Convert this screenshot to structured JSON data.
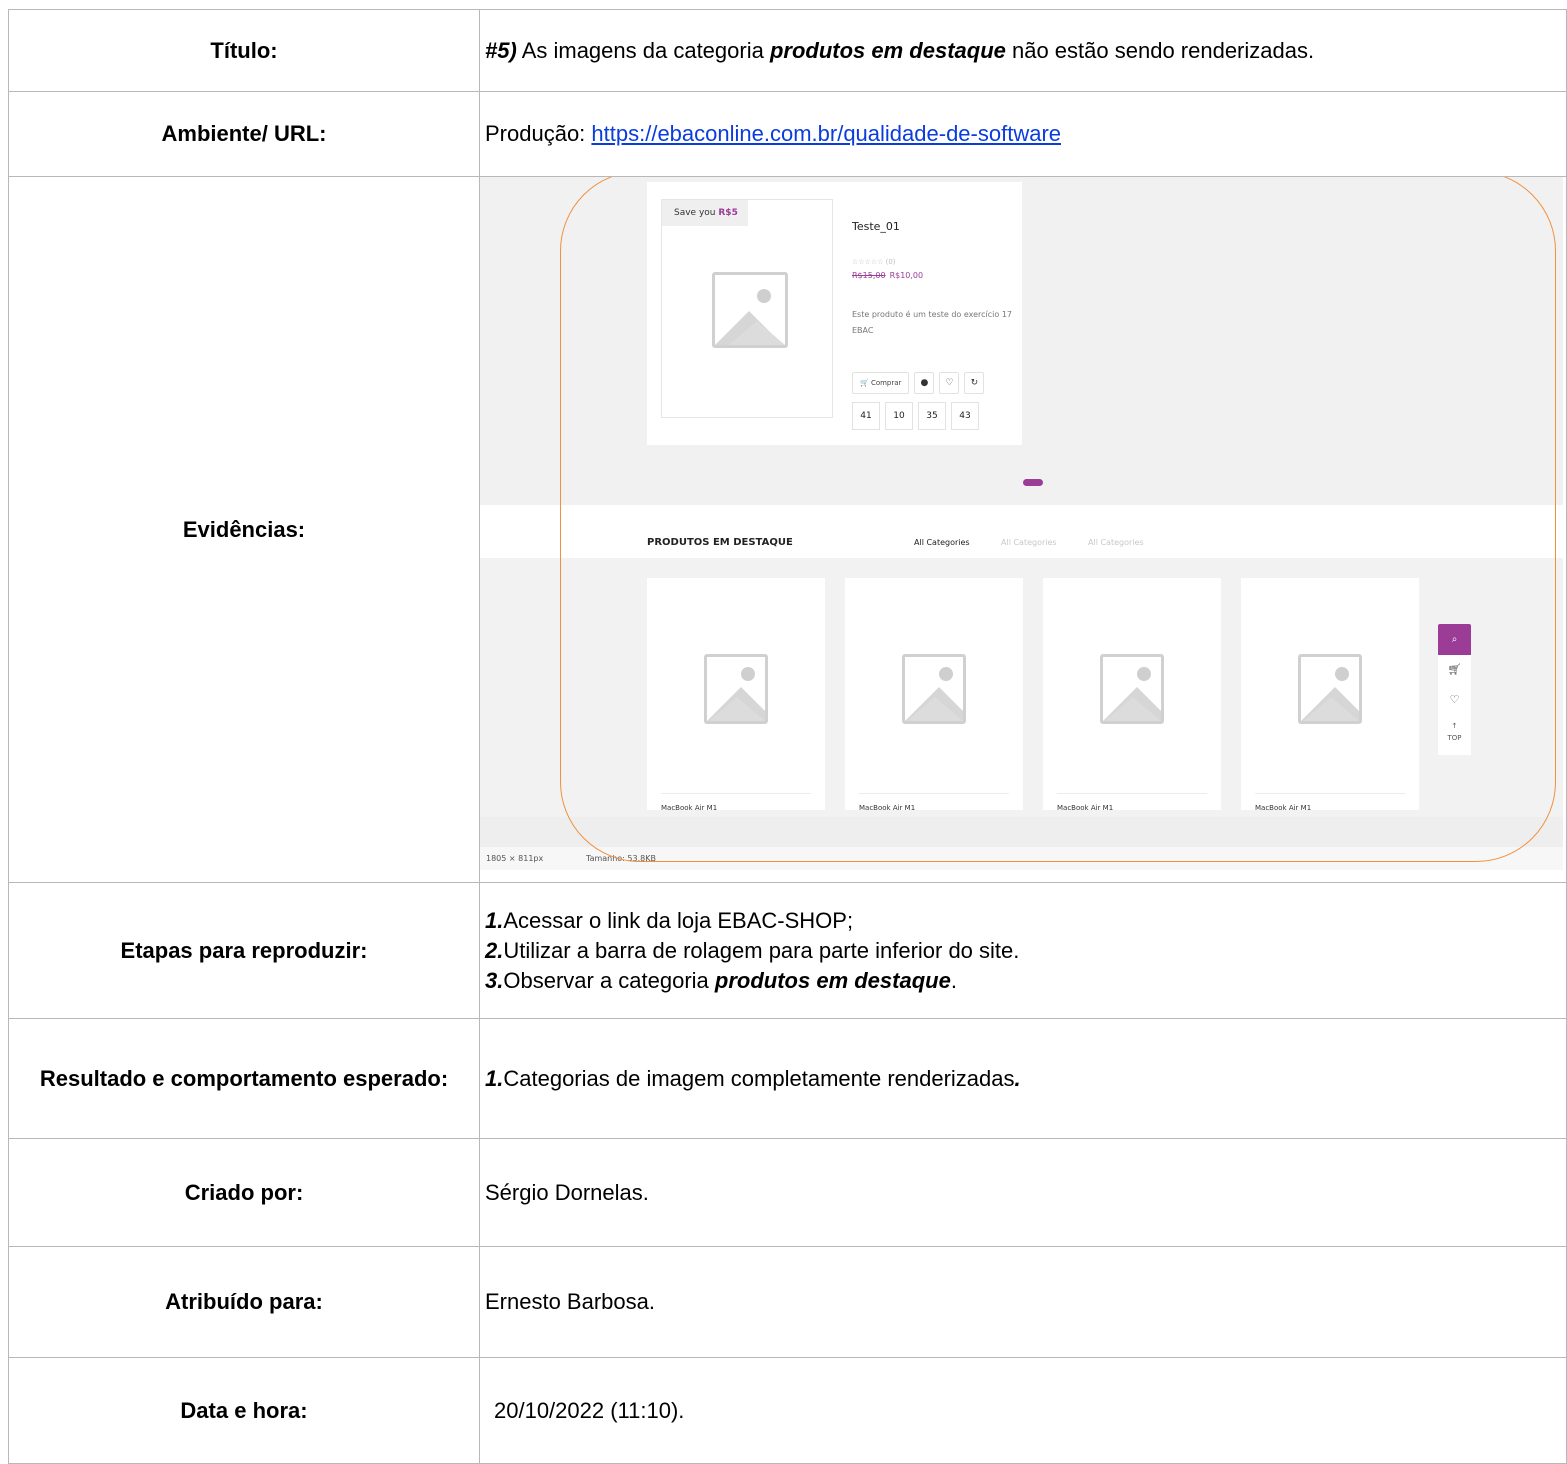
{
  "rows": {
    "titulo": {
      "label": "Título:",
      "prefix": "#5)",
      "text1": " As imagens da categoria ",
      "emph": "produtos em destaque",
      "text2": " não estão sendo renderizadas."
    },
    "ambiente": {
      "label": "Ambiente/ URL:",
      "prefix": "Produção: ",
      "url": "https://ebaconline.com.br/qualidade-de-software"
    },
    "evidencias": {
      "label": "Evidências:"
    },
    "etapas": {
      "label": "Etapas para reproduzir:",
      "steps": [
        {
          "num": "1.",
          "text": "Acessar o link da loja EBAC-SHOP;"
        },
        {
          "num": "2.",
          "text": "Utilizar a barra de rolagem para parte inferior do site."
        },
        {
          "num": "3.",
          "text_pre": "Observar a categoria ",
          "emph": "produtos em destaque",
          "text_post": "."
        }
      ]
    },
    "resultado": {
      "label": "Resultado e comportamento esperado:",
      "num": "1.",
      "text": "Categorias de imagem completamente renderizadas",
      "end": "."
    },
    "criado": {
      "label": "Criado por:",
      "value": "Sérgio Dornelas."
    },
    "atribuido": {
      "label": "Atribuído para:",
      "value": "Ernesto Barbosa."
    },
    "data": {
      "label": "Data e hora:",
      "value": "20/10/2022 (11:10)."
    }
  },
  "screenshot": {
    "save_tag": "Save you",
    "save_amount": "R$5",
    "product_name": "Teste_01",
    "stars": "☆☆☆☆☆ (0)",
    "old_price": "R$15,00",
    "new_price": "R$10,00",
    "description": "Este produto é um teste do exercício 17 EBAC",
    "buy_button": "🛒 Comprar",
    "countdown": [
      "41",
      "10",
      "35",
      "43"
    ],
    "section_title": "PRODUTOS EM DESTAQUE",
    "categories": [
      "All Categories",
      "All Categories",
      "All Categories"
    ],
    "product_cards": [
      "MacBook Air M1",
      "MacBook Air M1",
      "MacBook Air M1",
      "MacBook Air M1"
    ],
    "side_top": "TOP",
    "status_dims": "1805 × 811px",
    "status_size": "Tamanho: 53.8KB",
    "accent_color": "#9b3c97",
    "outline_color": "#f0913f"
  }
}
